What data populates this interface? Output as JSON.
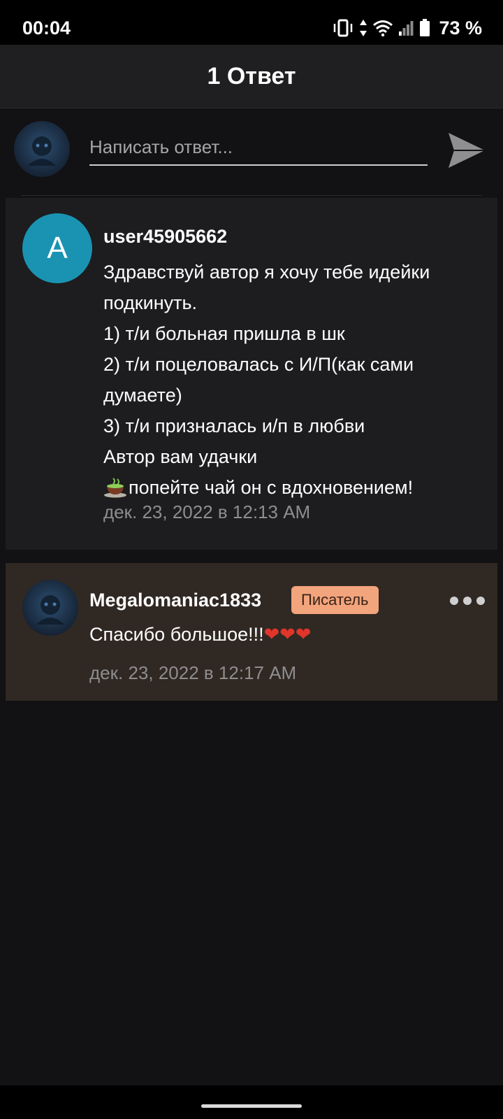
{
  "status_bar": {
    "time": "00:04",
    "battery": "73 %",
    "icons": [
      "vibrate-icon",
      "data-arrows-icon",
      "wifi-icon",
      "signal-icon",
      "battery-icon"
    ]
  },
  "header": {
    "title": "1 Ответ"
  },
  "composer": {
    "placeholder": "Написать ответ...",
    "avatar_icon": "user-avatar",
    "send_icon": "send-icon"
  },
  "comment": {
    "avatar_letter": "A",
    "avatar_color": "#1a93b2",
    "username": "user45905662",
    "lines": [
      "Здравствуй автор я хочу тебе идейки подкинуть.",
      "1) т/и больная пришла в шк",
      "2) т/и поцеловалась с И/П(как сами думаете)",
      "3) т/и призналась и/п в любви",
      "Автор вам удачки",
      "попейте чай он с вдохновением!"
    ],
    "last_line_icon": "tea-cup-icon",
    "timestamp": "дек. 23, 2022 в 12:13 AM"
  },
  "reply": {
    "username": "Megalomaniac1833",
    "badge": "Писатель",
    "badge_color": "#f2a47c",
    "text": "Спасибо большое!!!",
    "hearts": "❤❤❤",
    "timestamp": "дек. 23, 2022 в 12:17 AM",
    "more_icon": "more-options-icon"
  }
}
